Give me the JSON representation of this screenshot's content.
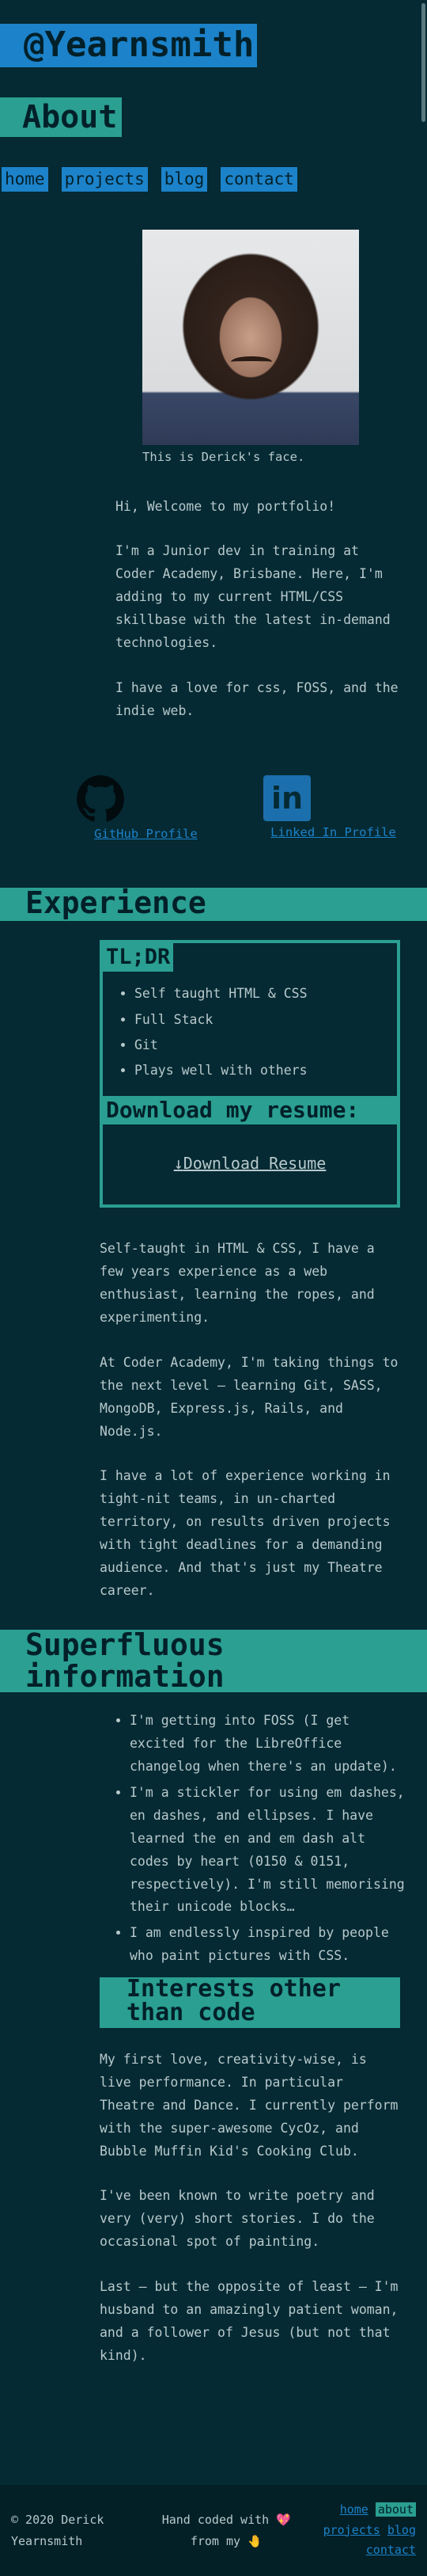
{
  "site": {
    "brand": "@Yearnsmith",
    "page_title": "About"
  },
  "nav": {
    "items": [
      {
        "label": "home"
      },
      {
        "label": "projects"
      },
      {
        "label": "blog"
      },
      {
        "label": "contact"
      }
    ]
  },
  "portrait": {
    "caption": "This is Derick's face."
  },
  "intro": {
    "paragraphs": [
      "Hi, Welcome to my portfolio!",
      "I'm a Junior dev in training at Coder Academy, Brisbane. Here, I'm adding to my current HTML/CSS skillbase with the latest in-demand technologies.",
      "I have a love for css, FOSS, and the indie web."
    ]
  },
  "socials": {
    "github_label": "GitHub Profile",
    "linkedin_label": "Linked In Profile",
    "linkedin_glyph": "in"
  },
  "experience": {
    "title": "Experience",
    "tldr_heading": "TL;DR",
    "tldr_items": [
      "Self taught HTML & CSS",
      "Full Stack",
      "Git",
      "Plays well with others"
    ],
    "download_heading": "Download my resume:",
    "download_link": "Download Resume",
    "download_icon": "↓",
    "paragraphs": [
      "Self-taught in HTML & CSS, I have a few years experience as a web enthusiast, learning the ropes, and experimenting.",
      "At Coder Academy, I'm taking things to the next level — learning Git, SASS, MongoDB, Express.js, Rails, and Node.js.",
      "I have a lot of experience working in tight-nit teams, in un-charted territory, on results driven projects with tight deadlines for a demanding audience. And that's just my Theatre career."
    ]
  },
  "superfluous": {
    "title": "Superfluous information",
    "items": [
      "I'm getting into FOSS (I get excited for the LibreOffice changelog when there's an update).",
      "I'm a stickler for using em dashes, en dashes, and ellipses. I have learned the en and em dash alt codes by heart (0150 & 0151, respectively). I'm still memorising their unicode blocks…",
      "I am endlessly inspired by people who paint pictures with CSS."
    ],
    "interests_title": "Interests other than code",
    "interest_paragraphs": [
      "My first love, creativity-wise, is live performance. In particular Theatre and Dance. I currently perform with the super-awesome CycOz, and Bubble Muffin Kid's Cooking Club.",
      "I've been known to write poetry and very (very) short stories. I do the occasional spot of painting.",
      "Last — but the opposite of least — I'm husband to an amazingly patient woman, and a follower of Jesus (but not that kind)."
    ]
  },
  "footer": {
    "copyright": "© 2020 Derick Yearnsmith",
    "hand_coded": "Hand coded with",
    "heart_glyph": "💖",
    "from_my": "from my",
    "hand_glyph": "🤚",
    "nav": [
      {
        "label": "home"
      },
      {
        "label": "about"
      },
      {
        "label": "projects"
      },
      {
        "label": "blog"
      },
      {
        "label": "contact"
      }
    ]
  },
  "colors": {
    "background": "#052a33",
    "blue_accent": "#1c82c9",
    "teal_accent": "#2a9f92",
    "text": "#b8c9cc"
  }
}
